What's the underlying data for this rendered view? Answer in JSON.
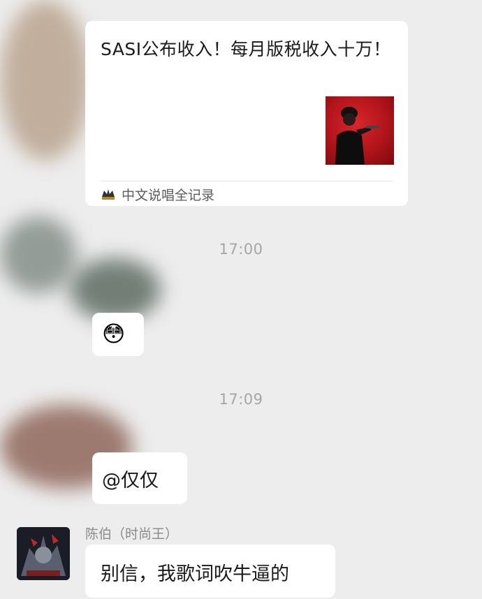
{
  "link_card": {
    "title": "SASI公布收入！每月版税收入十万！",
    "source_name": "中文说唱全记录"
  },
  "timestamps": [
    "17:00",
    "17:09"
  ],
  "messages": [
    {
      "type": "emoji",
      "icon": "flushed-face-emoji",
      "glyph": "😳"
    },
    {
      "type": "text",
      "text": "@仅仅"
    },
    {
      "type": "text",
      "sender": "陈伯（时尚王）",
      "text": "别信，我歌词吹牛逼的"
    }
  ],
  "colors": {
    "background": "#ededed",
    "bubble": "#ffffff",
    "thumbnail_red": "#c41a20"
  }
}
